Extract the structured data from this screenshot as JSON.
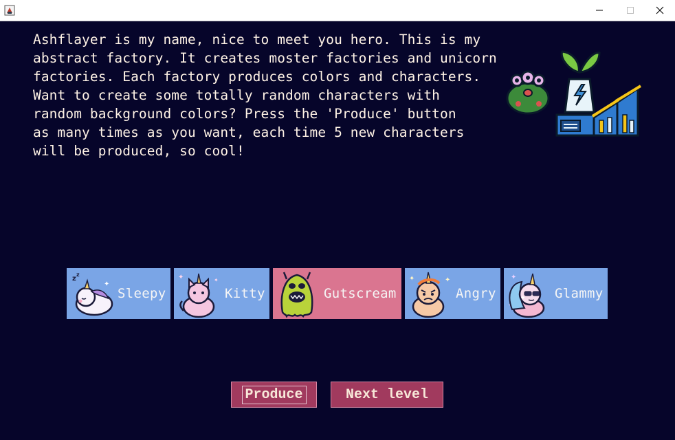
{
  "window": {
    "app_icon": "java-app-icon",
    "controls": [
      "minimize-icon",
      "maximize-icon",
      "close-icon"
    ]
  },
  "intro_text": "Ashflayer is my name, nice to meet you hero. This is my\nabstract factory. It creates moster factories and unicorn\nfactories. Each factory produces colors and characters.\nWant to create some totally random characters with\nrandom background colors? Press the 'Produce' button\nas many times as you want, each time 5 new characters\nwill be produced, so cool!",
  "characters": [
    {
      "name": "Sleepy",
      "icon": "sleepy-unicorn-icon",
      "bg": "#7aa5e6"
    },
    {
      "name": "Kitty",
      "icon": "kitty-unicorn-icon",
      "bg": "#7aa5e6"
    },
    {
      "name": "Gutscream",
      "icon": "slime-monster-icon",
      "bg": "#da7590"
    },
    {
      "name": "Angry",
      "icon": "angry-unicorn-icon",
      "bg": "#7aa5e6"
    },
    {
      "name": "Glammy",
      "icon": "glammy-unicorn-icon",
      "bg": "#7aa5e6"
    }
  ],
  "buttons": {
    "produce": "Produce",
    "next_level": "Next level"
  },
  "colors": {
    "background": "#06052a",
    "button": "#a13a5e",
    "text": "#fff3e6"
  }
}
